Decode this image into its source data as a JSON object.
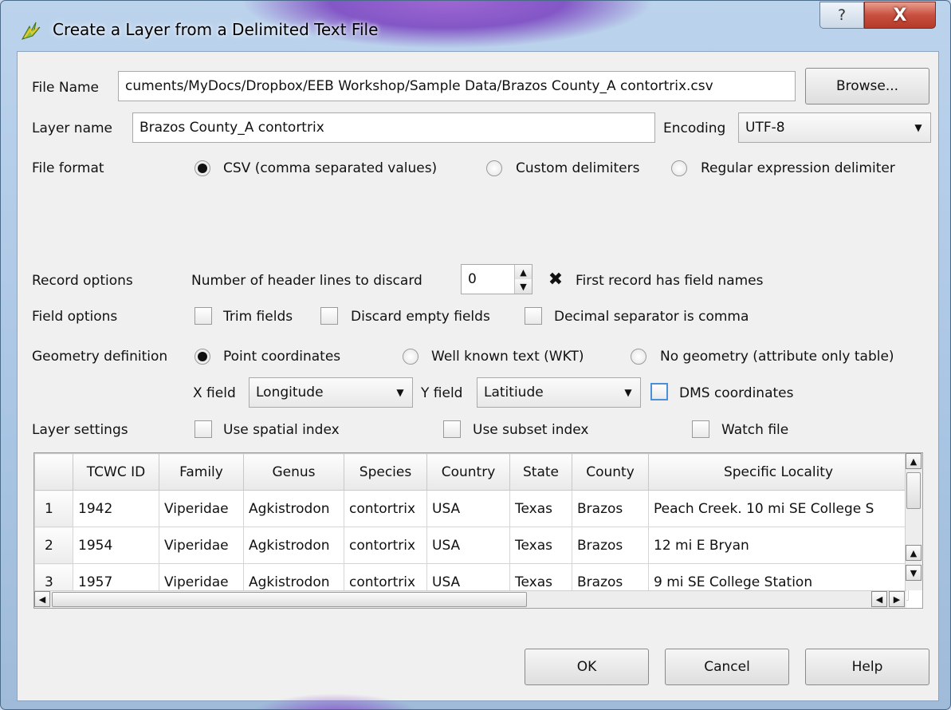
{
  "window": {
    "title": "Create a Layer from a Delimited Text File",
    "help_glyph": "?",
    "close_glyph": "X"
  },
  "file": {
    "label": "File Name",
    "value": "cuments/MyDocs/Dropbox/EEB Workshop/Sample Data/Brazos County_A contortrix.csv",
    "browse_label": "Browse..."
  },
  "layer": {
    "label": "Layer name",
    "value": "Brazos County_A contortrix",
    "encoding_label": "Encoding",
    "encoding_value": "UTF-8"
  },
  "format": {
    "label": "File format",
    "options": [
      "CSV (comma separated values)",
      "Custom delimiters",
      "Regular expression delimiter"
    ],
    "selected": 0
  },
  "record": {
    "label": "Record options",
    "header_lines_label": "Number of header lines to discard",
    "header_lines_value": "0",
    "first_record_label": "First record has field names",
    "first_record_checked": true
  },
  "field": {
    "label": "Field options",
    "trim_label": "Trim fields",
    "discard_label": "Discard empty fields",
    "decimal_label": "Decimal separator is comma"
  },
  "geometry": {
    "label": "Geometry definition",
    "options": [
      "Point coordinates",
      "Well known text (WKT)",
      "No geometry (attribute only table)"
    ],
    "selected": 0,
    "x_label": "X field",
    "x_value": "Longitude",
    "y_label": "Y field",
    "y_value": "Latitiude",
    "dms_label": "DMS coordinates"
  },
  "settings": {
    "label": "Layer settings",
    "spatial_label": "Use spatial index",
    "subset_label": "Use subset index",
    "watch_label": "Watch file"
  },
  "table": {
    "columns": [
      "TCWC ID",
      "Family",
      "Genus",
      "Species",
      "Country",
      "State",
      "County",
      "Specific Locality"
    ],
    "rows": [
      {
        "n": "1",
        "cells": [
          "1942",
          "Viperidae",
          "Agkistrodon",
          "contortrix",
          "USA",
          "Texas",
          "Brazos",
          "Peach Creek. 10 mi SE College S"
        ]
      },
      {
        "n": "2",
        "cells": [
          "1954",
          "Viperidae",
          "Agkistrodon",
          "contortrix",
          "USA",
          "Texas",
          "Brazos",
          "12 mi E Bryan"
        ]
      },
      {
        "n": "3",
        "cells": [
          "1957",
          "Viperidae",
          "Agkistrodon",
          "contortrix",
          "USA",
          "Texas",
          "Brazos",
          "9 mi SE College Station"
        ]
      }
    ]
  },
  "buttons": {
    "ok": "OK",
    "cancel": "Cancel",
    "help": "Help"
  }
}
